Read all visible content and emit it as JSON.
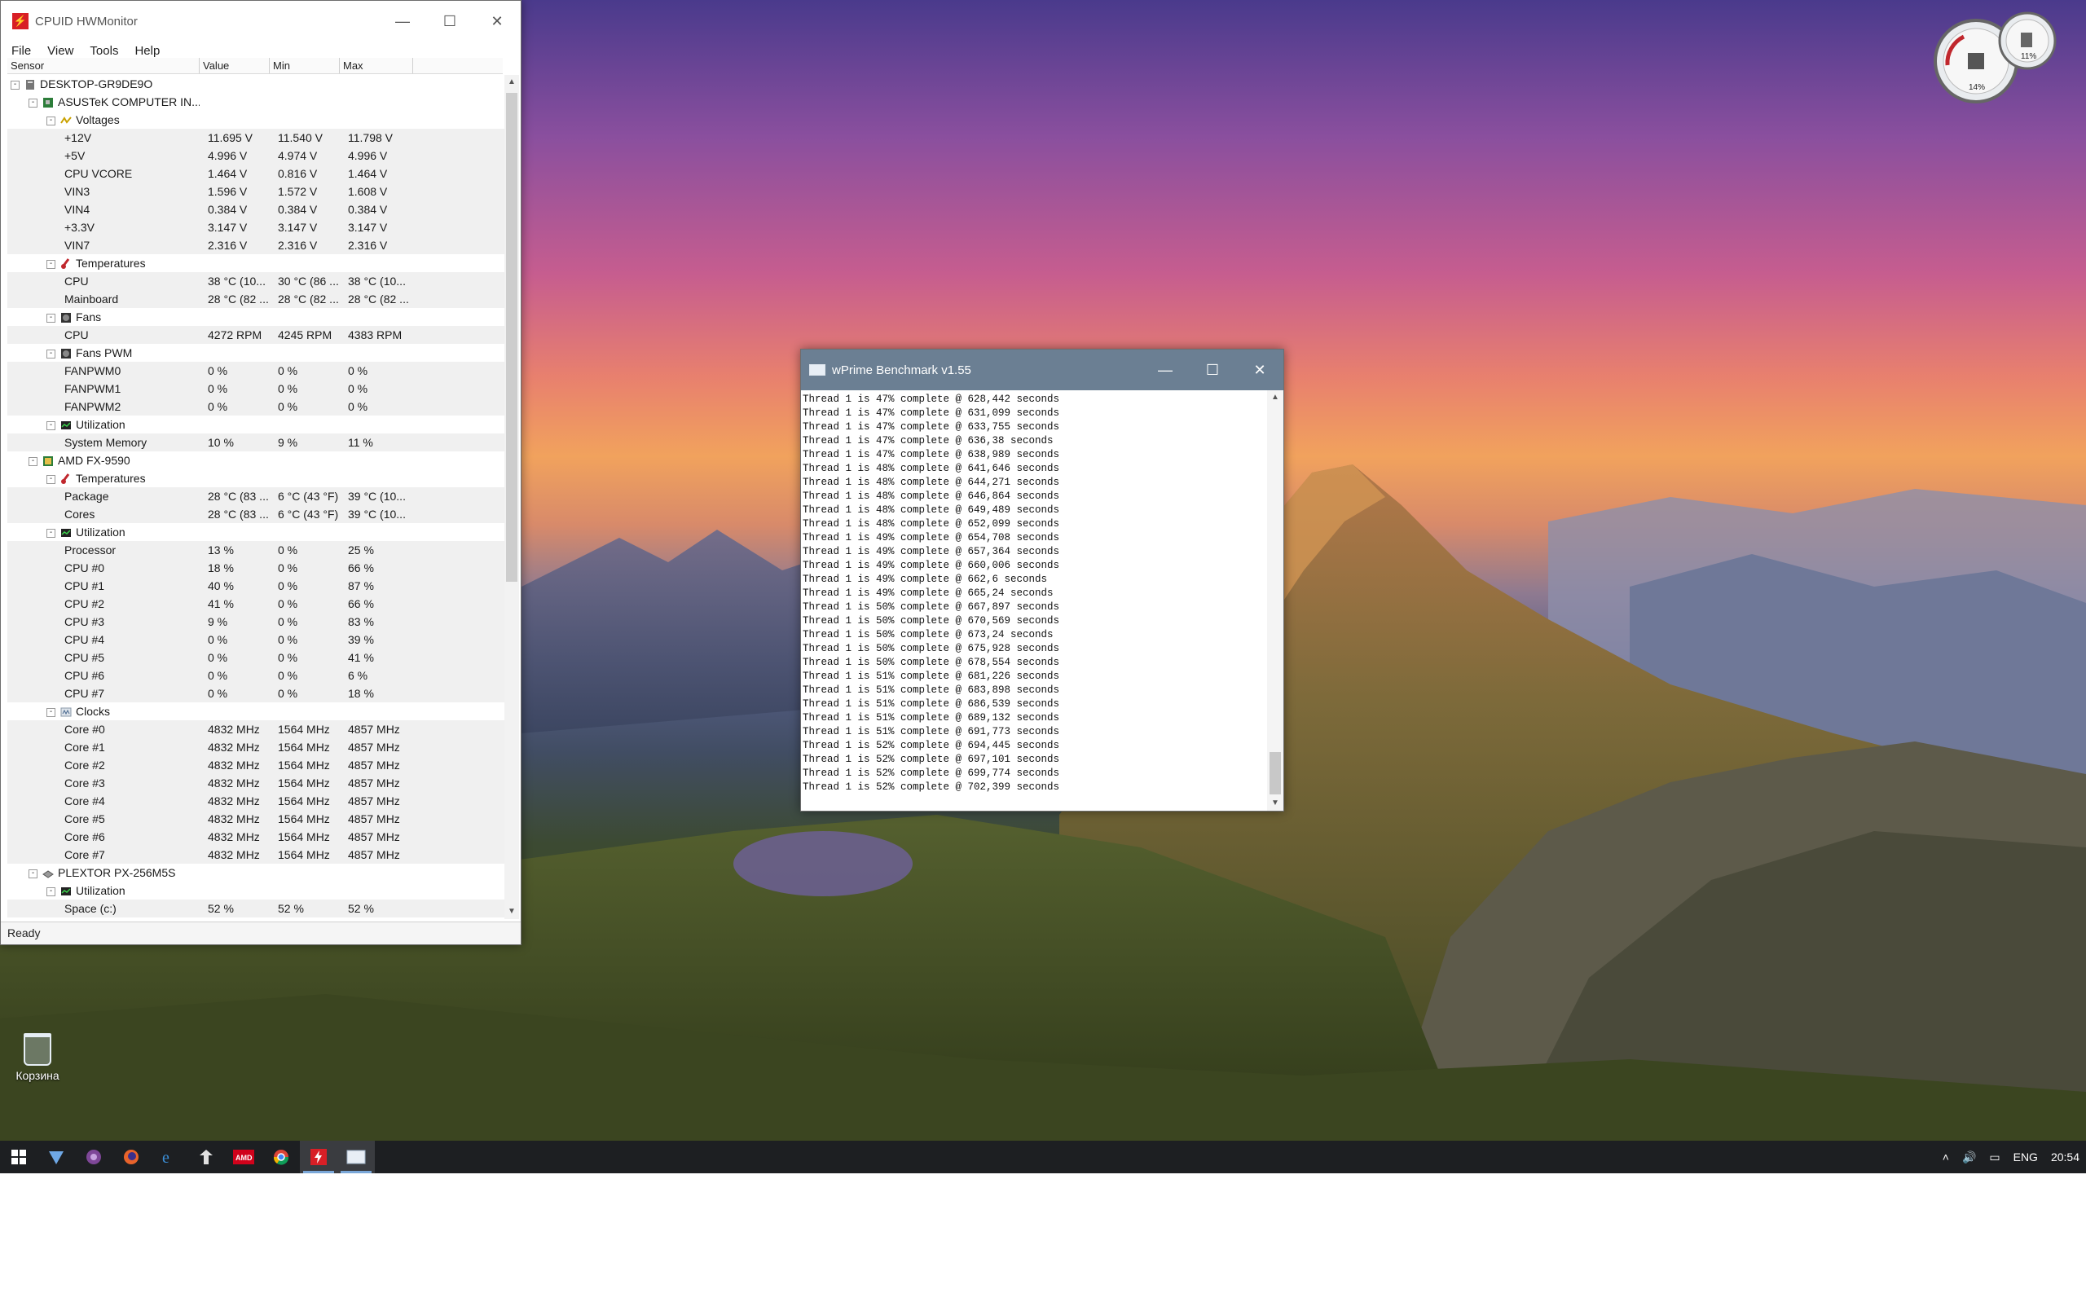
{
  "hwmonitor": {
    "title": "CPUID HWMonitor",
    "menu": [
      "File",
      "View",
      "Tools",
      "Help"
    ],
    "columns": [
      "Sensor",
      "Value",
      "Min",
      "Max"
    ],
    "status": "Ready",
    "rows": [
      {
        "name": "DESKTOP-GR9DE9O",
        "level": 0,
        "icon": "computer-icon",
        "expand": "-"
      },
      {
        "name": "ASUSTeK COMPUTER IN...",
        "level": 1,
        "icon": "motherboard-icon",
        "expand": "-"
      },
      {
        "name": "Voltages",
        "level": 2,
        "icon": "voltage-icon",
        "expand": "-"
      },
      {
        "name": "+12V",
        "level": 3,
        "value": "11.695 V",
        "min": "11.540 V",
        "max": "11.798 V"
      },
      {
        "name": "+5V",
        "level": 3,
        "value": "4.996 V",
        "min": "4.974 V",
        "max": "4.996 V"
      },
      {
        "name": "CPU VCORE",
        "level": 3,
        "value": "1.464 V",
        "min": "0.816 V",
        "max": "1.464 V"
      },
      {
        "name": "VIN3",
        "level": 3,
        "value": "1.596 V",
        "min": "1.572 V",
        "max": "1.608 V"
      },
      {
        "name": "VIN4",
        "level": 3,
        "value": "0.384 V",
        "min": "0.384 V",
        "max": "0.384 V"
      },
      {
        "name": "+3.3V",
        "level": 3,
        "value": "3.147 V",
        "min": "3.147 V",
        "max": "3.147 V"
      },
      {
        "name": "VIN7",
        "level": 3,
        "value": "2.316 V",
        "min": "2.316 V",
        "max": "2.316 V"
      },
      {
        "name": "Temperatures",
        "level": 2,
        "icon": "thermometer-icon",
        "expand": "-"
      },
      {
        "name": "CPU",
        "level": 3,
        "value": "38 °C (10...",
        "min": "30 °C (86 ...",
        "max": "38 °C (10..."
      },
      {
        "name": "Mainboard",
        "level": 3,
        "value": "28 °C (82 ...",
        "min": "28 °C (82 ...",
        "max": "28 °C (82 ..."
      },
      {
        "name": "Fans",
        "level": 2,
        "icon": "fan-icon",
        "expand": "-"
      },
      {
        "name": "CPU",
        "level": 3,
        "value": "4272 RPM",
        "min": "4245 RPM",
        "max": "4383 RPM"
      },
      {
        "name": "Fans PWM",
        "level": 2,
        "icon": "fan-icon",
        "expand": "-"
      },
      {
        "name": "FANPWM0",
        "level": 3,
        "value": "0 %",
        "min": "0 %",
        "max": "0 %"
      },
      {
        "name": "FANPWM1",
        "level": 3,
        "value": "0 %",
        "min": "0 %",
        "max": "0 %"
      },
      {
        "name": "FANPWM2",
        "level": 3,
        "value": "0 %",
        "min": "0 %",
        "max": "0 %"
      },
      {
        "name": "Utilization",
        "level": 2,
        "icon": "utilization-icon",
        "expand": "-"
      },
      {
        "name": "System Memory",
        "level": 3,
        "value": "10 %",
        "min": "9 %",
        "max": "11 %"
      },
      {
        "name": "AMD FX-9590",
        "level": 1,
        "icon": "cpu-icon",
        "expand": "-"
      },
      {
        "name": "Temperatures",
        "level": 2,
        "icon": "thermometer-icon",
        "expand": "-"
      },
      {
        "name": "Package",
        "level": 3,
        "value": "28 °C (83 ...",
        "min": "6 °C (43 °F)",
        "max": "39 °C (10..."
      },
      {
        "name": "Cores",
        "level": 3,
        "value": "28 °C (83 ...",
        "min": "6 °C (43 °F)",
        "max": "39 °C (10..."
      },
      {
        "name": "Utilization",
        "level": 2,
        "icon": "utilization-icon",
        "expand": "-"
      },
      {
        "name": "Processor",
        "level": 3,
        "value": "13 %",
        "min": "0 %",
        "max": "25 %"
      },
      {
        "name": "CPU #0",
        "level": 3,
        "value": "18 %",
        "min": "0 %",
        "max": "66 %"
      },
      {
        "name": "CPU #1",
        "level": 3,
        "value": "40 %",
        "min": "0 %",
        "max": "87 %"
      },
      {
        "name": "CPU #2",
        "level": 3,
        "value": "41 %",
        "min": "0 %",
        "max": "66 %"
      },
      {
        "name": "CPU #3",
        "level": 3,
        "value": "9 %",
        "min": "0 %",
        "max": "83 %"
      },
      {
        "name": "CPU #4",
        "level": 3,
        "value": "0 %",
        "min": "0 %",
        "max": "39 %"
      },
      {
        "name": "CPU #5",
        "level": 3,
        "value": "0 %",
        "min": "0 %",
        "max": "41 %"
      },
      {
        "name": "CPU #6",
        "level": 3,
        "value": "0 %",
        "min": "0 %",
        "max": "6 %"
      },
      {
        "name": "CPU #7",
        "level": 3,
        "value": "0 %",
        "min": "0 %",
        "max": "18 %"
      },
      {
        "name": "Clocks",
        "level": 2,
        "icon": "clock-icon",
        "expand": "-"
      },
      {
        "name": "Core #0",
        "level": 3,
        "value": "4832 MHz",
        "min": "1564 MHz",
        "max": "4857 MHz"
      },
      {
        "name": "Core #1",
        "level": 3,
        "value": "4832 MHz",
        "min": "1564 MHz",
        "max": "4857 MHz"
      },
      {
        "name": "Core #2",
        "level": 3,
        "value": "4832 MHz",
        "min": "1564 MHz",
        "max": "4857 MHz"
      },
      {
        "name": "Core #3",
        "level": 3,
        "value": "4832 MHz",
        "min": "1564 MHz",
        "max": "4857 MHz"
      },
      {
        "name": "Core #4",
        "level": 3,
        "value": "4832 MHz",
        "min": "1564 MHz",
        "max": "4857 MHz"
      },
      {
        "name": "Core #5",
        "level": 3,
        "value": "4832 MHz",
        "min": "1564 MHz",
        "max": "4857 MHz"
      },
      {
        "name": "Core #6",
        "level": 3,
        "value": "4832 MHz",
        "min": "1564 MHz",
        "max": "4857 MHz"
      },
      {
        "name": "Core #7",
        "level": 3,
        "value": "4832 MHz",
        "min": "1564 MHz",
        "max": "4857 MHz"
      },
      {
        "name": "PLEXTOR PX-256M5S",
        "level": 1,
        "icon": "drive-icon",
        "expand": "-"
      },
      {
        "name": "Utilization",
        "level": 2,
        "icon": "utilization-icon",
        "expand": "-"
      },
      {
        "name": "Space (c:)",
        "level": 3,
        "value": "52 %",
        "min": "52 %",
        "max": "52 %"
      }
    ]
  },
  "wprime": {
    "title": "wPrime Benchmark v1.55",
    "lines": [
      "Thread 1 is 47% complete @ 628,442 seconds",
      "Thread 1 is 47% complete @ 631,099 seconds",
      "Thread 1 is 47% complete @ 633,755 seconds",
      "Thread 1 is 47% complete @ 636,38 seconds",
      "Thread 1 is 47% complete @ 638,989 seconds",
      "Thread 1 is 48% complete @ 641,646 seconds",
      "Thread 1 is 48% complete @ 644,271 seconds",
      "Thread 1 is 48% complete @ 646,864 seconds",
      "Thread 1 is 48% complete @ 649,489 seconds",
      "Thread 1 is 48% complete @ 652,099 seconds",
      "Thread 1 is 49% complete @ 654,708 seconds",
      "Thread 1 is 49% complete @ 657,364 seconds",
      "Thread 1 is 49% complete @ 660,006 seconds",
      "Thread 1 is 49% complete @ 662,6 seconds",
      "Thread 1 is 49% complete @ 665,24 seconds",
      "Thread 1 is 50% complete @ 667,897 seconds",
      "Thread 1 is 50% complete @ 670,569 seconds",
      "Thread 1 is 50% complete @ 673,24 seconds",
      "Thread 1 is 50% complete @ 675,928 seconds",
      "Thread 1 is 50% complete @ 678,554 seconds",
      "Thread 1 is 51% complete @ 681,226 seconds",
      "Thread 1 is 51% complete @ 683,898 seconds",
      "Thread 1 is 51% complete @ 686,539 seconds",
      "Thread 1 is 51% complete @ 689,132 seconds",
      "Thread 1 is 51% complete @ 691,773 seconds",
      "Thread 1 is 52% complete @ 694,445 seconds",
      "Thread 1 is 52% complete @ 697,101 seconds",
      "Thread 1 is 52% complete @ 699,774 seconds",
      "Thread 1 is 52% complete @ 702,399 seconds"
    ]
  },
  "gadget": {
    "readout_left": "14%",
    "readout_right": "11%"
  },
  "desktop": {
    "recycle_bin_label": "Корзина"
  },
  "taskbar": {
    "apps": [
      "start-icon",
      "browser-icon",
      "tor-icon",
      "firefox-icon",
      "edge-icon",
      "app-icon",
      "amd-icon",
      "chrome-icon",
      "hwmonitor-icon",
      "wprime-icon"
    ],
    "tray": {
      "language": "ENG",
      "time": "20:54"
    }
  },
  "colors": {
    "accent": "#6b7f93",
    "hwmonitor_red": "#d81f26",
    "taskbar": "#1d1f22"
  }
}
